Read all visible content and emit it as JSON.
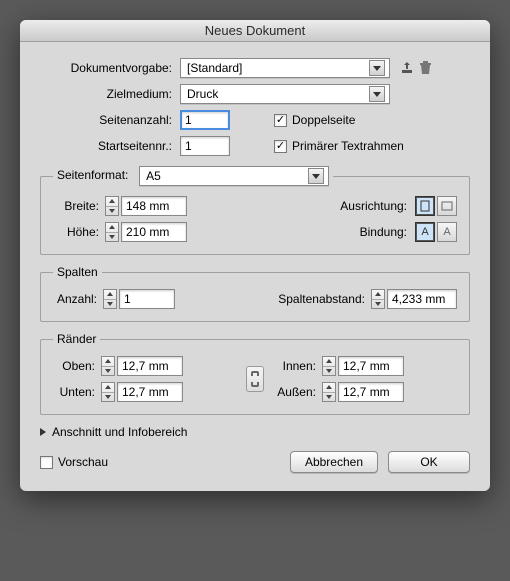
{
  "window": {
    "title": "Neues Dokument"
  },
  "preset": {
    "label": "Dokumentvorgabe:",
    "value": "[Standard]"
  },
  "intent": {
    "label": "Zielmedium:",
    "value": "Druck"
  },
  "pages": {
    "count_label": "Seitenanzahl:",
    "count_value": "1",
    "start_label": "Startseitennr.:",
    "start_value": "1",
    "facing_label": "Doppelseite",
    "primary_label": "Primärer Textrahmen"
  },
  "format": {
    "legend_label": "Seitenformat:",
    "value": "A5",
    "width_label": "Breite:",
    "width_value": "148 mm",
    "height_label": "Höhe:",
    "height_value": "210 mm",
    "orient_label": "Ausrichtung:",
    "binding_label": "Bindung:"
  },
  "columns": {
    "legend": "Spalten",
    "count_label": "Anzahl:",
    "count_value": "1",
    "gutter_label": "Spaltenabstand:",
    "gutter_value": "4,233 mm"
  },
  "margins": {
    "legend": "Ränder",
    "top_label": "Oben:",
    "top_value": "12,7 mm",
    "bottom_label": "Unten:",
    "bottom_value": "12,7 mm",
    "inside_label": "Innen:",
    "inside_value": "12,7 mm",
    "outside_label": "Außen:",
    "outside_value": "12,7 mm"
  },
  "disclosure": {
    "label": "Anschnitt und Infobereich"
  },
  "preview": {
    "label": "Vorschau"
  },
  "buttons": {
    "cancel": "Abbrechen",
    "ok": "OK"
  }
}
